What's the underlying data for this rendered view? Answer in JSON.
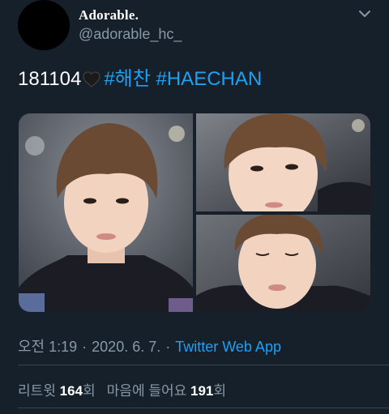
{
  "user": {
    "display_name": "Adorable.",
    "handle": "@adorable_hc_"
  },
  "tweet": {
    "text_prefix": "181104",
    "hashtags": [
      "#해찬",
      "#HAECHAN"
    ]
  },
  "media": {
    "photos": [
      {
        "name": "photo-left"
      },
      {
        "name": "photo-top-right"
      },
      {
        "name": "photo-bottom-right"
      }
    ]
  },
  "meta": {
    "time": "오전 1:19",
    "separator": "·",
    "date": "2020. 6. 7.",
    "source": "Twitter Web App"
  },
  "stats": {
    "retweets_label": "리트윗",
    "retweets_count": "164",
    "retweets_suffix": "회",
    "likes_label": "마음에 들어요",
    "likes_count": "191",
    "likes_suffix": "회"
  },
  "colors": {
    "background": "#15202b",
    "link": "#1da1f2",
    "muted": "#8899a6",
    "divider": "#38444d"
  },
  "icons": {
    "caret": "chevron-down-icon",
    "heart": "black-heart-icon"
  }
}
